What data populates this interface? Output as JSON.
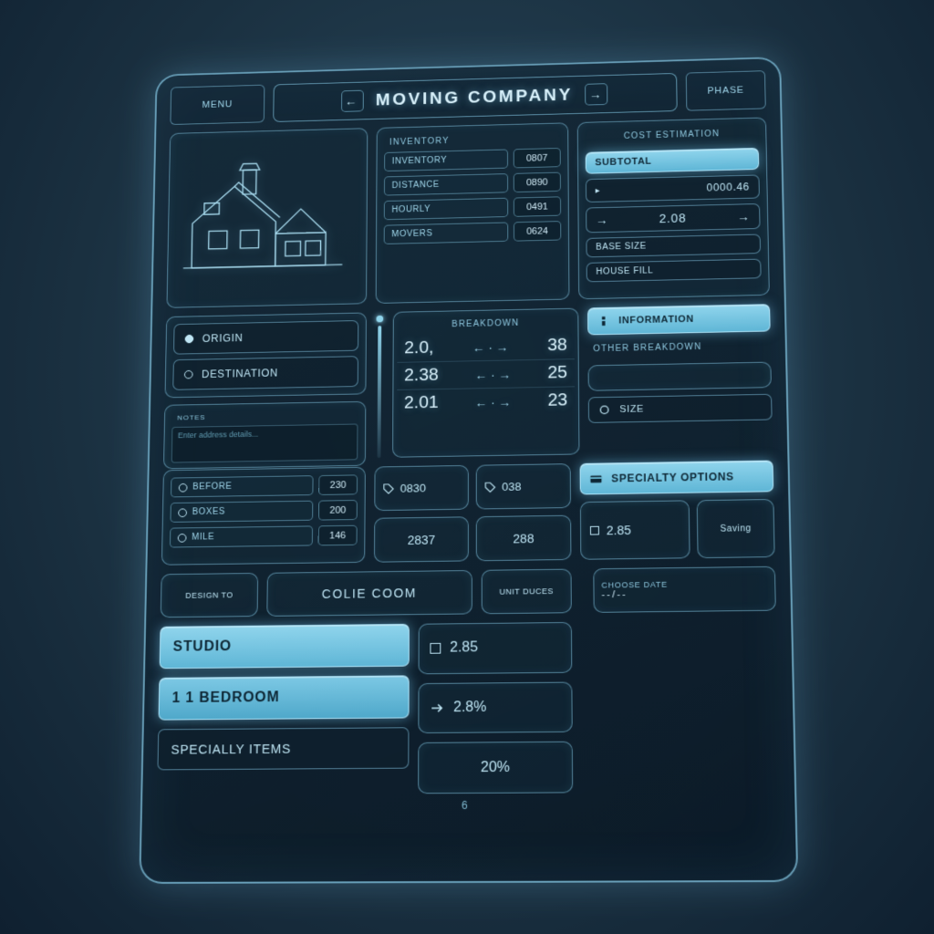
{
  "header": {
    "corner_label": "Menu",
    "title": "Moving Company",
    "side_chip": "Phase"
  },
  "illustration": {
    "caption_tiny": "Inventory"
  },
  "metrics_panel": {
    "rows": [
      {
        "label": "Inventory",
        "value": "0807"
      },
      {
        "label": "Distance",
        "value": "0890"
      },
      {
        "label": "Hourly",
        "value": "0491"
      },
      {
        "label": "Movers",
        "value": "0624"
      }
    ]
  },
  "cost_panel": {
    "title": "Cost Estimation",
    "rows": [
      {
        "label": "Subtotal"
      },
      {
        "label": "0000.46"
      },
      {
        "label": "2.08",
        "has_arrow": true
      },
      {
        "label": "Base Size"
      },
      {
        "label": "House Fill"
      }
    ],
    "info_btn": "Information",
    "section2_title": "Other Breakdown",
    "size_btn": "Size",
    "specialty_btn": "Specialty Options",
    "extra1": "2.85",
    "extra2": "Saving",
    "date_label": "Choose Date",
    "date_value": "--/--"
  },
  "locations": {
    "origin_label": "Origin",
    "destination_label": "Destination",
    "notes_title": "Notes",
    "notes_placeholder": "Enter address details..."
  },
  "calc_panel": {
    "title": "Breakdown",
    "rows": [
      {
        "left": "2.0,",
        "right": "38"
      },
      {
        "left": "2.38",
        "right": "25"
      },
      {
        "left": "2.01",
        "right": "23"
      }
    ]
  },
  "small_list": {
    "rows": [
      {
        "label": "Before",
        "value": "230"
      },
      {
        "label": "Boxes",
        "value": "200"
      },
      {
        "label": "Mile",
        "value": "146"
      }
    ]
  },
  "grid4": {
    "cells": [
      {
        "icon": "tag",
        "text": "0830"
      },
      {
        "icon": "tag",
        "text": "038"
      },
      {
        "icon": "num",
        "text": "2837"
      },
      {
        "icon": "num",
        "text": "288"
      }
    ]
  },
  "strip": {
    "left_label": "Design To",
    "mid_label": "Colie Coom",
    "right_label": "Unit Duces"
  },
  "home_sizes": {
    "options": [
      {
        "label": "Studio"
      },
      {
        "label": "1 1 Bedroom"
      },
      {
        "label": "Specially Items"
      }
    ]
  },
  "mid_stack": {
    "items": [
      {
        "icon": "square",
        "text": "2.85"
      },
      {
        "icon": "arrow",
        "text": "2.8%"
      },
      {
        "icon": "none",
        "text": "20%"
      }
    ]
  },
  "footer": {
    "page": "6"
  }
}
